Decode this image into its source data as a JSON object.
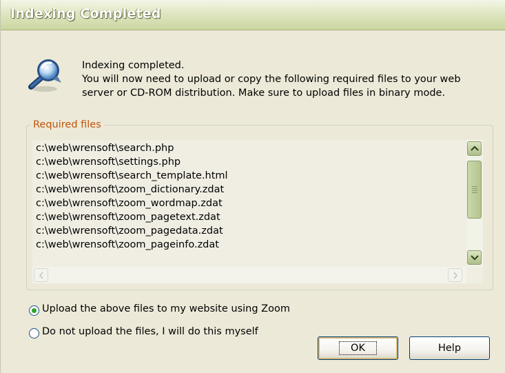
{
  "window": {
    "title": "Indexing Completed"
  },
  "message": {
    "line1": "Indexing completed.",
    "line2": "You will now need to upload or copy the following required files to your web",
    "line3": "server or CD-ROM distribution. Make sure to upload files in binary mode."
  },
  "required_files": {
    "legend": "Required files",
    "files": [
      "c:\\web\\wrensoft\\search.php",
      "c:\\web\\wrensoft\\settings.php",
      "c:\\web\\wrensoft\\search_template.html",
      "c:\\web\\wrensoft\\zoom_dictionary.zdat",
      "c:\\web\\wrensoft\\zoom_wordmap.zdat",
      "c:\\web\\wrensoft\\zoom_pagetext.zdat",
      "c:\\web\\wrensoft\\zoom_pagedata.zdat",
      "c:\\web\\wrensoft\\zoom_pageinfo.zdat"
    ]
  },
  "options": {
    "upload_label": "Upload the above files to my website using Zoom",
    "no_upload_label": "Do not upload the files, I will do this myself",
    "selected": "upload"
  },
  "buttons": {
    "ok": "OK",
    "help": "Help"
  },
  "icons": {
    "main": "magnifier-icon"
  },
  "colors": {
    "legend": "#c0540c",
    "title_bar": "#cbd6a0",
    "radio_selected": "#2ba52b"
  }
}
